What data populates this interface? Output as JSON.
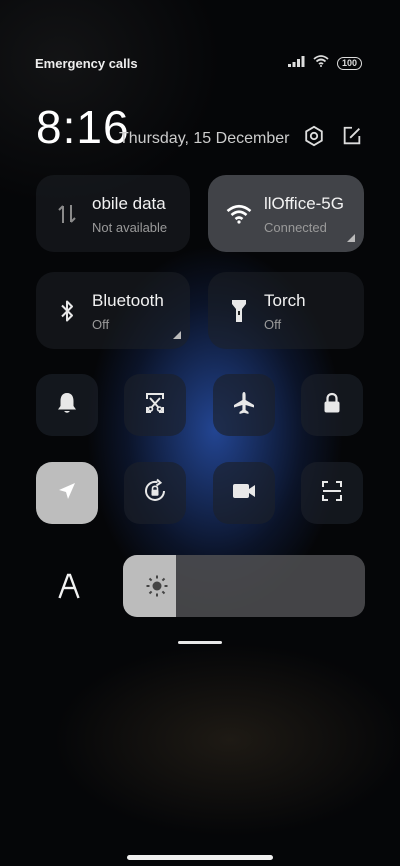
{
  "status": {
    "left_text": "Emergency calls o",
    "battery": "100"
  },
  "header": {
    "time": "8:16",
    "date": "Thursday, 15 December"
  },
  "tiles": {
    "mobile_data": {
      "title": "obile data",
      "subtitle": "Not available"
    },
    "wifi": {
      "title": "llOffice-5G",
      "subtitle": "Connected"
    },
    "bluetooth": {
      "title": "Bluetooth",
      "subtitle": "Off"
    },
    "torch": {
      "title": "Torch",
      "subtitle": "Off"
    }
  },
  "brightness": {
    "level": 0.22
  }
}
